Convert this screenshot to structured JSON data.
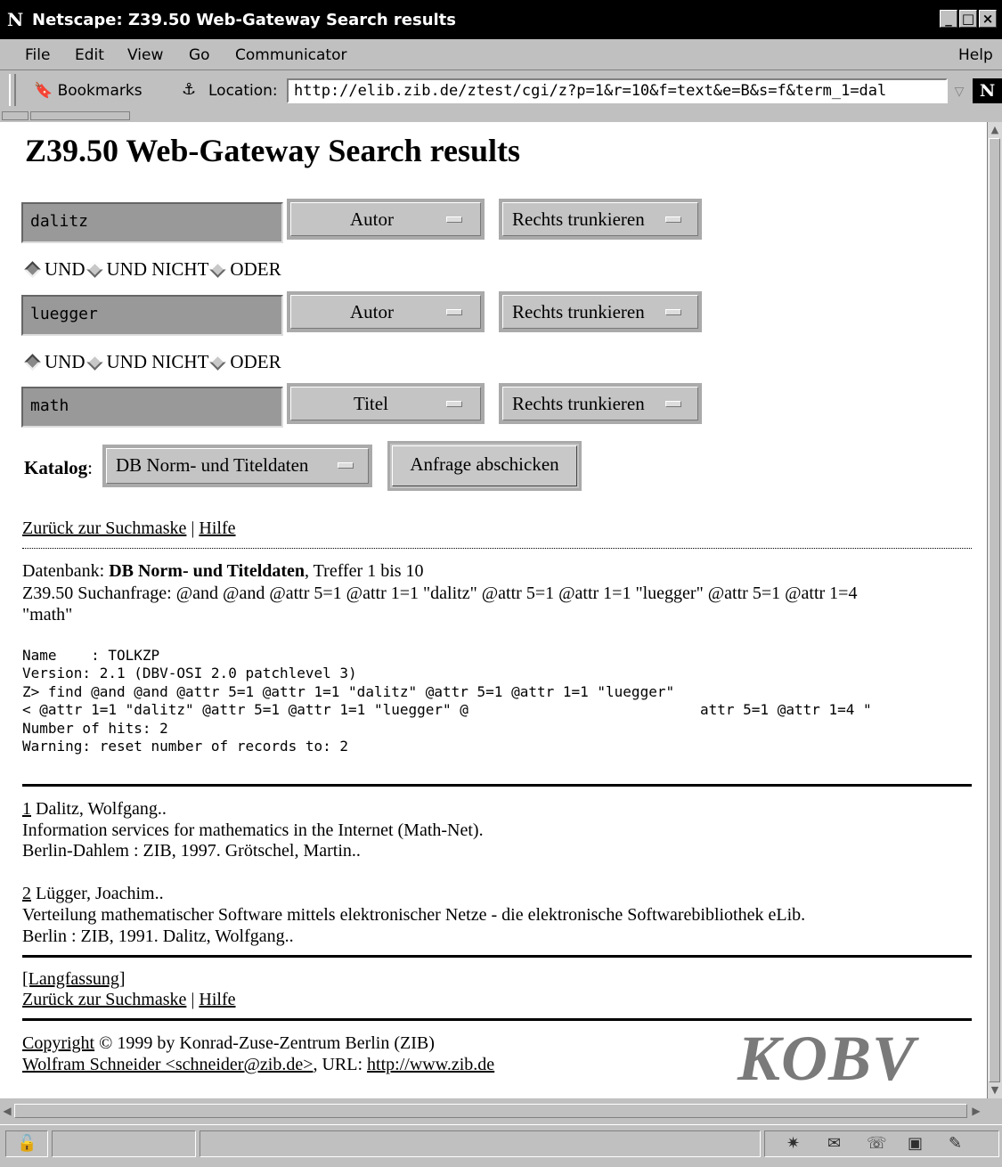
{
  "window": {
    "title": "Netscape: Z39.50 Web-Gateway Search results",
    "app_icon": "N",
    "buttons": [
      "_",
      "□",
      "×"
    ]
  },
  "menubar": {
    "file": "File",
    "edit": "Edit",
    "view": "View",
    "go": "Go",
    "communicator": "Communicator",
    "help": "Help"
  },
  "location_bar": {
    "bookmarks_label": "Bookmarks",
    "location_label": "Location:",
    "url": "http://elib.zib.de/ztest/cgi/z?p=1&r=10&f=text&e=B&s=f&term_1=dal",
    "logo": "N"
  },
  "page": {
    "title": "Z39.50 Web-Gateway Search results",
    "search_rows": [
      {
        "term": "dalitz",
        "field": "Autor",
        "truncation": "Rechts trunkieren"
      },
      {
        "term": "luegger",
        "field": "Autor",
        "truncation": "Rechts trunkieren"
      },
      {
        "term": "math",
        "field": "Titel",
        "truncation": "Rechts trunkieren"
      }
    ],
    "operators": [
      {
        "und": "UND",
        "und_nicht": "UND NICHT",
        "oder": "ODER",
        "selected": "UND"
      },
      {
        "und": "UND",
        "und_nicht": "UND NICHT",
        "oder": "ODER",
        "selected": "UND"
      }
    ],
    "katalog_label": "Katalog",
    "katalog_colon": ":",
    "katalog_value": "DB Norm- und Titeldaten",
    "submit_label": "Anfrage abschicken",
    "nav_links": {
      "back": "Zurück zur Suchmaske",
      "separator": " | ",
      "help": "Hilfe"
    },
    "result_info": {
      "db_label": "Datenbank: ",
      "db_name": "DB Norm- und Titeldaten",
      "hits_text": ", Treffer 1 bis 10",
      "query_line1": "Z39.50 Suchanfrage: @and @and @attr 5=1 @attr 1=1 \"dalitz\" @attr 5=1 @attr 1=1 \"luegger\" @attr 5=1 @attr 1=4",
      "query_line2": "\"math\""
    },
    "server_output": [
      "Name    : TOLKZP",
      "Version: 2.1 (DBV-OSI 2.0 patchlevel 3)",
      "Z> find @and @and @attr 5=1 @attr 1=1 \"dalitz\" @attr 5=1 @attr 1=1 \"luegger\"",
      "< @attr 1=1 \"dalitz\" @attr 5=1 @attr 1=1 \"luegger\" @                           attr 5=1 @attr 1=4 \"",
      "Number of hits: 2",
      "Warning: reset number of records to: 2"
    ],
    "records": [
      {
        "number": "1",
        "author": " Dalitz, Wolfgang..",
        "title": "Information services for mathematics in the Internet (Math-Net).",
        "imprint": "Berlin-Dahlem : ZIB, 1997. Grötschel, Martin.."
      },
      {
        "number": "2",
        "author": " Lügger, Joachim..",
        "title": "Verteilung mathematischer Software mittels elektronischer Netze - die elektronische Softwarebibliothek eLib.",
        "imprint": "Berlin : ZIB, 1991. Dalitz, Wolfgang.."
      }
    ],
    "langfassung": "[Langfassung]",
    "footer": {
      "copyright_link": "Copyright",
      "copyright_rest": " © 1999 by Konrad-Zuse-Zentrum Berlin (ZIB)",
      "author_link": "Wolfram Schneider <schneider@zib.de>",
      "url_label": ", URL: ",
      "url_link": "http://www.zib.de"
    },
    "logo_text": "KOBV"
  },
  "statusbar": {
    "icons": [
      "lock-icon",
      "network-icon",
      "mail-icon",
      "discussion-icon",
      "composer-icon",
      "edit-icon"
    ]
  }
}
